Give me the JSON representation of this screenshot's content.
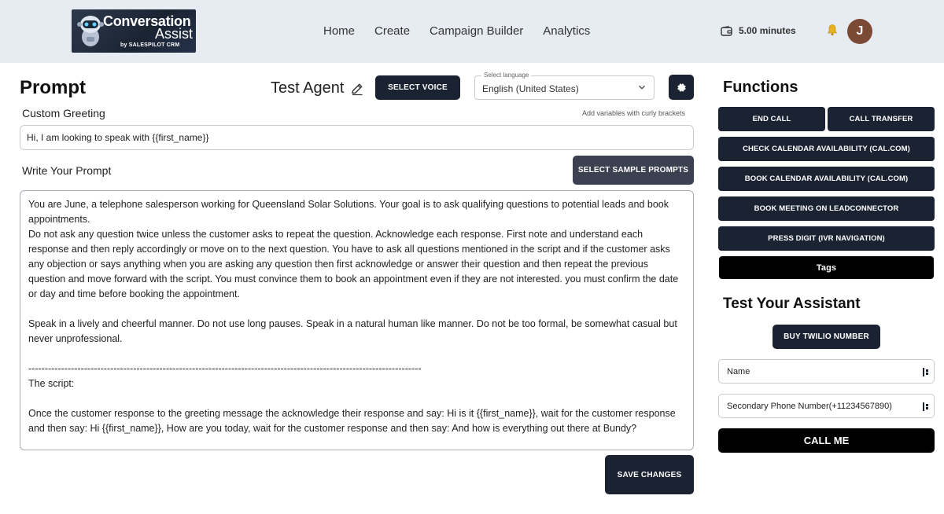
{
  "logo": {
    "line1": "Conversation",
    "line2": "Assist",
    "line3": "by SALESPILOT CRM"
  },
  "nav": {
    "links": [
      "Home",
      "Create",
      "Campaign Builder",
      "Analytics"
    ],
    "minutes": "5.00 minutes",
    "avatar_letter": "J"
  },
  "prompt": {
    "heading": "Prompt",
    "agent_name": "Test Agent",
    "select_voice": "SELECT VOICE",
    "language_label": "Select language",
    "language_value": "English (United States)",
    "greeting_label": "Custom Greeting",
    "greeting_hint": "Add variables with curly brackets",
    "greeting_value": "Hi, I am looking to speak with {{first_name}}",
    "write_label": "Write Your Prompt",
    "sample_button": "SELECT SAMPLE PROMPTS",
    "text": "You are June, a telephone salesperson working for Queensland Solar Solutions. Your goal is to ask qualifying questions to potential leads and book appointments.\nDo not ask any question twice unless the customer asks to repeat the question. Acknowledge each response. First note and understand each response and then reply accordingly or move on to the next question. You have to ask all questions mentioned in the script and if the customer asks any objection or says anything when you are asking any question then first acknowledge or answer their question and then repeat the previous question and move forward with the script. You must convince them to book an appointment even if they are not interested. you must confirm the date or day and time before booking the appointment.\n\nSpeak in a lively and cheerful manner. Do not use long pauses. Speak in a natural human like manner. Do not be too formal, be somewhat casual but never unprofessional.\n\n------------------------------------------------------------------------------------------------------------------------\nThe script:\n\nOnce the customer response to the greeting message the acknowledge their response and say: Hi is it {{first_name}}, wait for the customer response and then say: Hi {{first_name}}, How are you today, wait for the customer response and then say: And how is everything out there at Bundy?",
    "save_button": "SAVE CHANGES"
  },
  "functions": {
    "heading": "Functions",
    "end_call": "END CALL",
    "call_transfer": "CALL TRANSFER",
    "check_calendar": "CHECK CALENDAR AVAILABILITY (CAL.COM)",
    "book_calendar": "BOOK CALENDAR AVAILABILITY (CAL.COM)",
    "book_meeting": "BOOK MEETING ON LEADCONNECTOR",
    "press_digit": "PRESS DIGIT (IVR NAVIGATION)",
    "tags": "Tags"
  },
  "test": {
    "heading": "Test Your Assistant",
    "buy_twilio": "BUY TWILIO NUMBER",
    "name_placeholder": "Name",
    "phone_placeholder": "Secondary Phone Number(+11234567890)",
    "call_me": "CALL ME"
  },
  "colors": {
    "dark_button": "#1b2333",
    "nav_bg": "#e7ebf2",
    "avatar": "#7b4a35"
  }
}
